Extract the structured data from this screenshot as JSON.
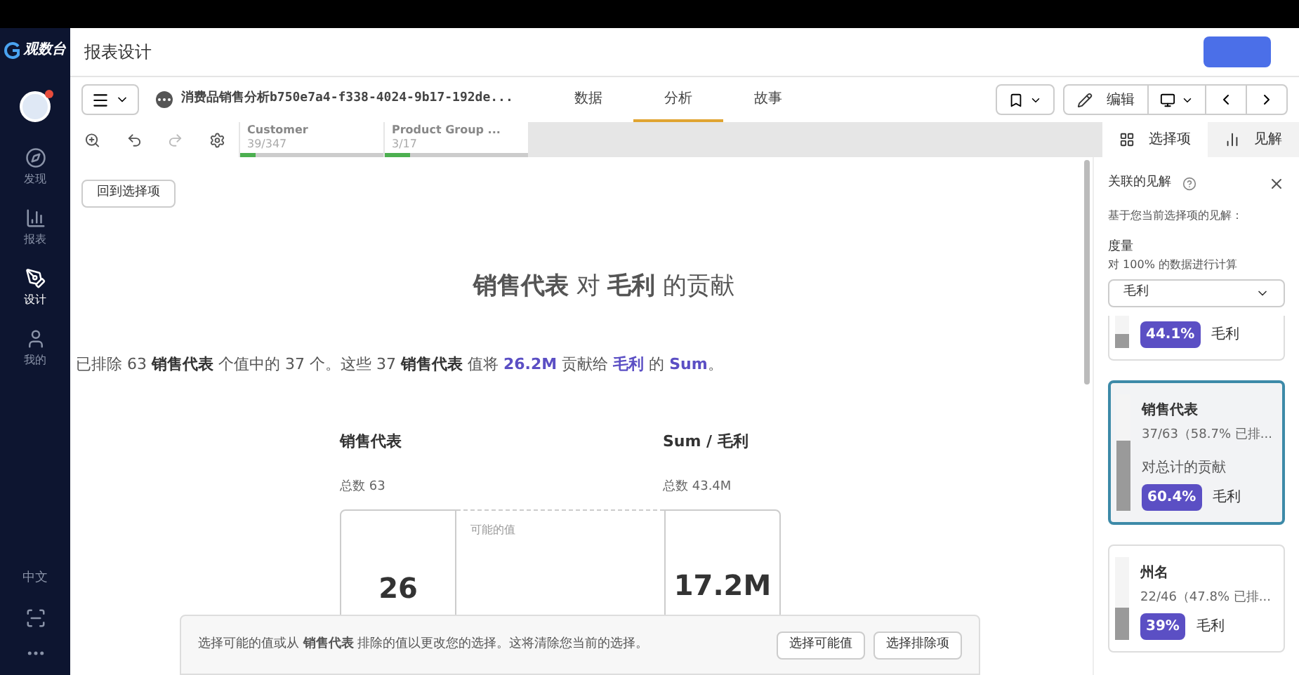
{
  "logo": {
    "text": "观数台"
  },
  "nav": [
    {
      "kind": "discover",
      "label": "发现",
      "selected": false
    },
    {
      "kind": "report",
      "label": "报表",
      "selected": false
    },
    {
      "kind": "design",
      "label": "设计",
      "selected": true
    },
    {
      "kind": "mine",
      "label": "我的",
      "selected": false
    }
  ],
  "nav_bottom": {
    "language": "中文"
  },
  "header": {
    "title": "报表设计"
  },
  "toolbar": {
    "app_name": "消费品销售分析b750e7a4-f338-4024-9b17-192de...",
    "tabs": [
      {
        "label": "数据",
        "selected": false
      },
      {
        "label": "分析",
        "selected": true
      },
      {
        "label": "故事",
        "selected": false
      }
    ],
    "edit_label": "编辑"
  },
  "selections": [
    {
      "field": "Customer",
      "count": "39/347",
      "level": 0.11
    },
    {
      "field": "Product Group ...",
      "count": "3/17",
      "level": 0.18
    }
  ],
  "panel_tabs": [
    {
      "label": "选择项",
      "selected": true
    },
    {
      "label": "见解",
      "selected": false
    }
  ],
  "main": {
    "back_button": "回到选择项",
    "title": "**销售代表** 对 **毛利** 的贡献",
    "summary": [
      {
        "kind": "plain",
        "text": "已排除 63 "
      },
      {
        "kind": "bold",
        "text": "销售代表"
      },
      {
        "kind": "plain",
        "text": " 个值中的 37 个。这些 37 "
      },
      {
        "kind": "bold",
        "text": "销售代表"
      },
      {
        "kind": "plain",
        "text": " 值将 "
      },
      {
        "kind": "accent",
        "text": "26.2M"
      },
      {
        "kind": "plain",
        "text": " 贡献给 "
      },
      {
        "kind": "accent",
        "text": "毛利"
      },
      {
        "kind": "plain",
        "text": " 的 "
      },
      {
        "kind": "accent",
        "text": "Sum"
      },
      {
        "kind": "plain",
        "text": "。"
      }
    ],
    "left_header": "销售代表",
    "left_total": "总数 63",
    "right_header": "Sum / 毛利",
    "right_total": "总数 43.4M",
    "left_value": "26",
    "middle_label": "可能的值",
    "right_value": "17.2M"
  },
  "toast": {
    "text": "选择可能的值或从 **销售代表** 排除的值以更改您的选择。这将清除您当前的选择。",
    "buttons": [
      "选择可能值",
      "选择排除项"
    ]
  },
  "insights": {
    "title": "关联的见解",
    "subtitle": "基于您当前选择项的见解：",
    "measure_label": "度量",
    "measure_note": "对 100% 的数据进行计算",
    "measure_value": "毛利",
    "cards": [
      {
        "kind": "partial",
        "percent": "44.1%",
        "measure": "毛利",
        "level": 0.441,
        "selected": false
      },
      {
        "kind": "full",
        "name": "销售代表",
        "detail": "37/63（58.7% 已排...",
        "caption": "对总计的贡献",
        "percent": "60.4%",
        "measure": "毛利",
        "level": 0.604,
        "selected": true
      },
      {
        "kind": "full",
        "name": "州名",
        "detail": "22/46（47.8% 已排...",
        "percent": "39%",
        "measure": "毛利",
        "level": 0.39,
        "selected": false
      }
    ]
  }
}
